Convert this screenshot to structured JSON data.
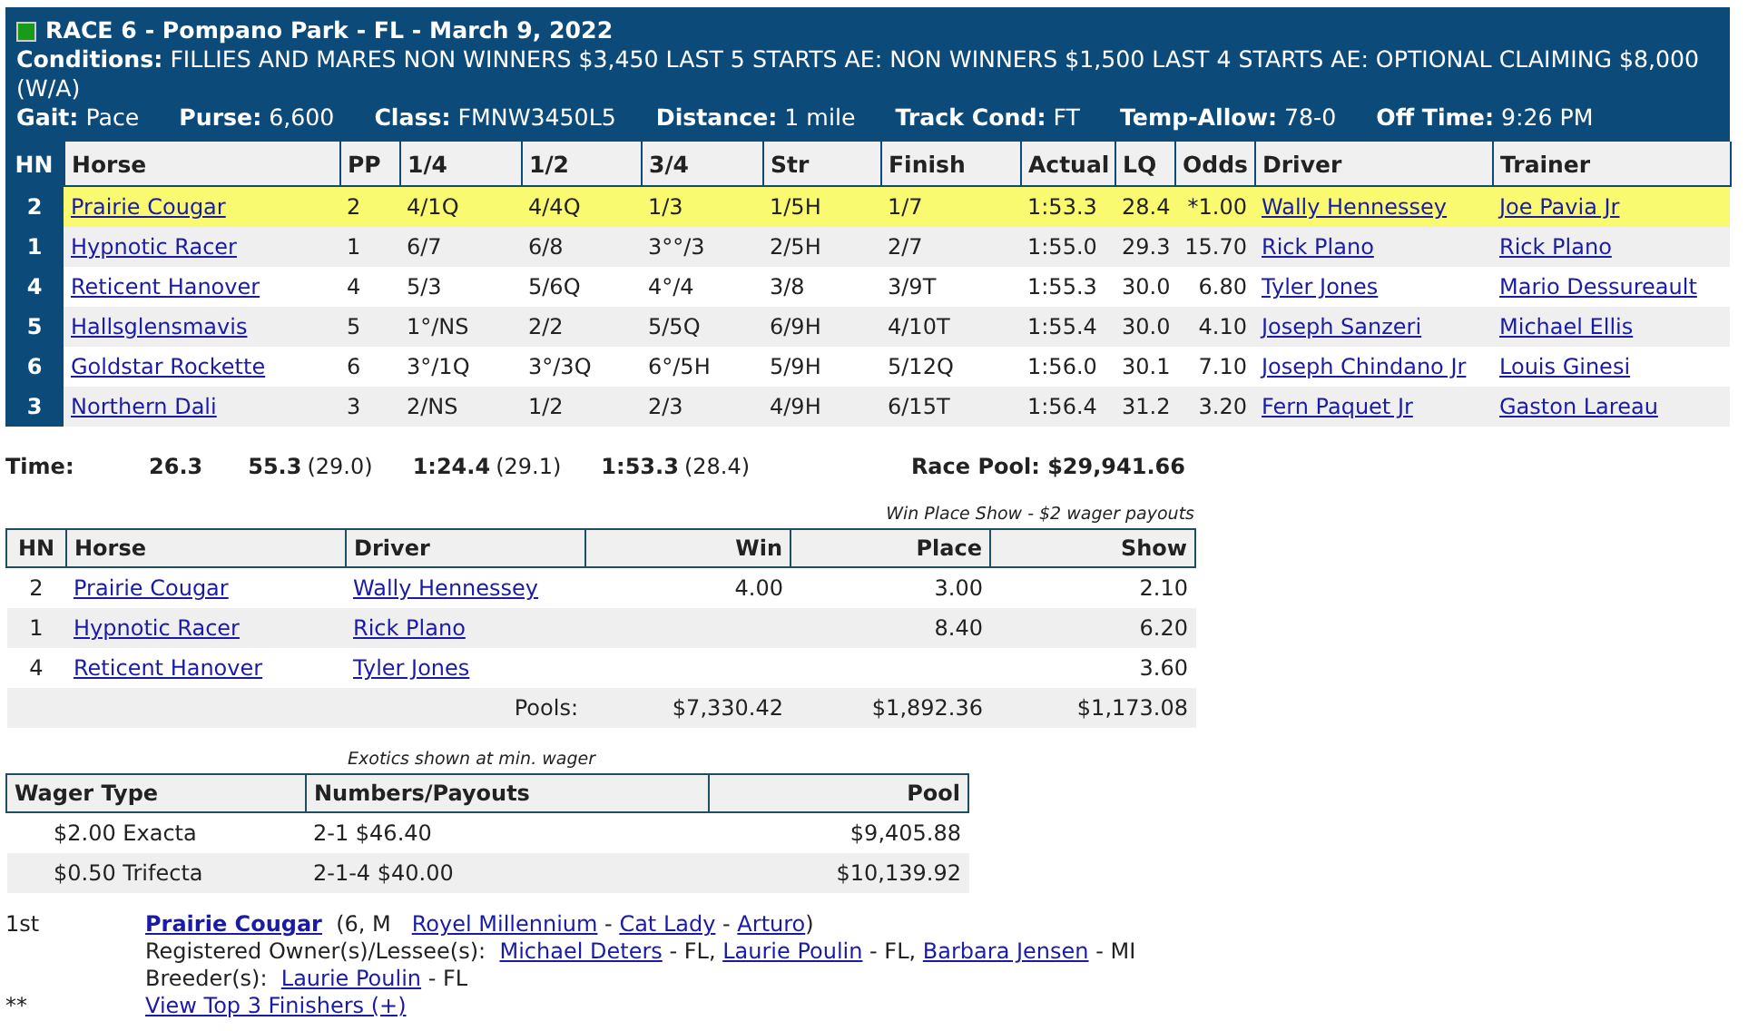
{
  "race": {
    "title": "RACE 6 - Pompano Park - FL - March 9, 2022",
    "conditions": "**Conditions:** FILLIES AND MARES NON WINNERS $3,450 LAST 5 STARTS AE: NON WINNERS $1,500 LAST 4 STARTS AE: OPTIONAL CLAIMING $8,000 (W/A)",
    "fields": [
      "**Gait:** Pace",
      "**Purse:** 6,600",
      "**Class:** FMNW3450L5",
      "**Distance:** 1 mile",
      "**Track Cond:** FT",
      "**Temp-Allow:** 78-0",
      "**Off Time:** 9:26 PM"
    ]
  },
  "results": {
    "columns": [
      "HN",
      "Horse",
      "PP",
      "1/4",
      "1/2",
      "3/4",
      "Str",
      "Finish",
      "Actual",
      "LQ",
      "Odds",
      "Driver",
      "Trainer"
    ],
    "rows": [
      {
        "highlighted": true,
        "cells": [
          "2",
          "Prairie Cougar",
          "2",
          "4/1Q",
          "4/4Q",
          "1/3",
          "1/5H",
          "1/7",
          "1:53.3",
          "28.4",
          "*1.00",
          "Wally Hennessey",
          "Joe Pavia Jr"
        ]
      },
      {
        "highlighted": false,
        "cells": [
          "1",
          "Hypnotic Racer",
          "1",
          "6/7",
          "6/8",
          "3°°/3",
          "2/5H",
          "2/7",
          "1:55.0",
          "29.3",
          "15.70",
          "Rick Plano",
          "Rick Plano"
        ]
      },
      {
        "highlighted": false,
        "cells": [
          "4",
          "Reticent Hanover",
          "4",
          "5/3",
          "5/6Q",
          "4°/4",
          "3/8",
          "3/9T",
          "1:55.3",
          "30.0",
          "6.80",
          "Tyler Jones",
          "Mario Dessureault"
        ]
      },
      {
        "highlighted": false,
        "cells": [
          "5",
          "Hallsglensmavis",
          "5",
          "1°/NS",
          "2/2",
          "5/5Q",
          "6/9H",
          "4/10T",
          "1:55.4",
          "30.0",
          "4.10",
          "Joseph Sanzeri",
          "Michael Ellis"
        ]
      },
      {
        "highlighted": false,
        "cells": [
          "6",
          "Goldstar Rockette",
          "6",
          "3°/1Q",
          "3°/3Q",
          "6°/5H",
          "5/9H",
          "5/12Q",
          "1:56.0",
          "30.1",
          "7.10",
          "Joseph Chindano Jr",
          "Louis Ginesi"
        ]
      },
      {
        "highlighted": false,
        "cells": [
          "3",
          "Northern Dali",
          "3",
          "2/NS",
          "1/2",
          "2/3",
          "4/9H",
          "6/15T",
          "1:56.4",
          "31.2",
          "3.20",
          "Fern Paquet Jr",
          "Gaston Lareau"
        ]
      }
    ]
  },
  "times": {
    "label": "Time:",
    "splits": [
      {
        "time": "26.3"
      },
      {
        "time": "55.3",
        "quarter": "(29.0)"
      },
      {
        "time": "1:24.4",
        "quarter": "(29.1)"
      },
      {
        "time": "1:53.3",
        "quarter": "(28.4)"
      }
    ],
    "race_pool": "Race Pool: $29,941.66"
  },
  "payouts": {
    "caption": "Win Place Show - $2 wager payouts",
    "columns": [
      "HN",
      "Horse",
      "Driver",
      "Win",
      "Place",
      "Show"
    ],
    "rows": [
      {
        "cells": [
          "2",
          "Prairie Cougar",
          "Wally Hennessey",
          "4.00",
          "3.00",
          "2.10"
        ]
      },
      {
        "cells": [
          "1",
          "Hypnotic Racer",
          "Rick Plano",
          "",
          "8.40",
          "6.20"
        ]
      },
      {
        "cells": [
          "4",
          "Reticent Hanover",
          "Tyler Jones",
          "",
          "",
          "3.60"
        ]
      }
    ],
    "pools": {
      "label": "Pools:",
      "values": [
        "$7,330.42",
        "$1,892.36",
        "$1,173.08"
      ]
    }
  },
  "exotics": {
    "caption": "Exotics shown at min. wager",
    "columns": [
      "Wager Type",
      "Numbers/Payouts",
      "Pool"
    ],
    "rows": [
      {
        "cells": [
          "$2.00 Exacta",
          "2-1 $46.40",
          "$9,405.88"
        ]
      },
      {
        "cells": [
          "$0.50 Trifecta",
          "2-1-4 $40.00",
          "$10,139.92"
        ]
      }
    ]
  },
  "finishers": [
    {
      "place": "1st",
      "lines": [
        [
          {
            "kind": "horse",
            "text": "Prairie Cougar"
          },
          {
            "kind": "text",
            "text": "  (6, M   "
          },
          {
            "kind": "link",
            "text": "Royel Millennium"
          },
          {
            "kind": "text",
            "text": " - "
          },
          {
            "kind": "link",
            "text": "Cat Lady"
          },
          {
            "kind": "text",
            "text": " - "
          },
          {
            "kind": "link",
            "text": "Arturo"
          },
          {
            "kind": "text",
            "text": ")"
          }
        ],
        [
          {
            "kind": "text",
            "text": "Registered Owner(s)/Lessee(s):  "
          },
          {
            "kind": "link",
            "text": "Michael Deters"
          },
          {
            "kind": "text",
            "text": " - FL, "
          },
          {
            "kind": "link",
            "text": "Laurie Poulin"
          },
          {
            "kind": "text",
            "text": " - FL, "
          },
          {
            "kind": "link",
            "text": "Barbara Jensen"
          },
          {
            "kind": "text",
            "text": " - MI"
          }
        ],
        [
          {
            "kind": "text",
            "text": "Breeder(s):  "
          },
          {
            "kind": "link",
            "text": "Laurie Poulin"
          },
          {
            "kind": "text",
            "text": " - FL"
          }
        ]
      ]
    },
    {
      "place": "**",
      "lines": [
        [
          {
            "kind": "link",
            "text": "View Top 3 Finishers (+)"
          }
        ]
      ]
    }
  ]
}
